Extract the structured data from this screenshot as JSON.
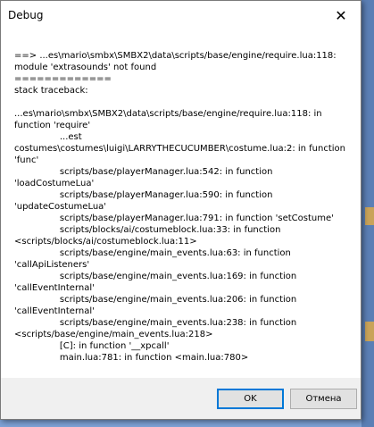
{
  "dialog": {
    "title": "Debug",
    "close_glyph": "✕",
    "message": "==> ...es\\mario\\smbx\\SMBX2\\data\\scripts/base/engine/require.lua:118: module 'extrasounds' not found\n=============\nstack traceback:\n\n...es\\mario\\smbx\\SMBX2\\data\\scripts/base/engine/require.lua:118: in function 'require'\n\t\t...est costumes\\costumes\\luigi\\LARRYTHECUCUMBER\\costume.lua:2: in function 'func'\n\t\tscripts/base/playerManager.lua:542: in function 'loadCostumeLua'\n\t\tscripts/base/playerManager.lua:590: in function 'updateCostumeLua'\n\t\tscripts/base/playerManager.lua:791: in function 'setCostume'\n\t\tscripts/blocks/ai/costumeblock.lua:33: in function <scripts/blocks/ai/costumeblock.lua:11>\n\t\tscripts/base/engine/main_events.lua:63: in function 'callApiListeners'\n\t\tscripts/base/engine/main_events.lua:169: in function 'callEventInternal'\n\t\tscripts/base/engine/main_events.lua:206: in function 'callEventInternal'\n\t\tscripts/base/engine/main_events.lua:238: in function <scripts/base/engine/main_events.lua:218>\n\t\t[C]: in function '__xpcall'\n\t\tmain.lua:781: in function <main.lua:780>",
    "ok_label": "OK",
    "cancel_label": "Отмена"
  }
}
